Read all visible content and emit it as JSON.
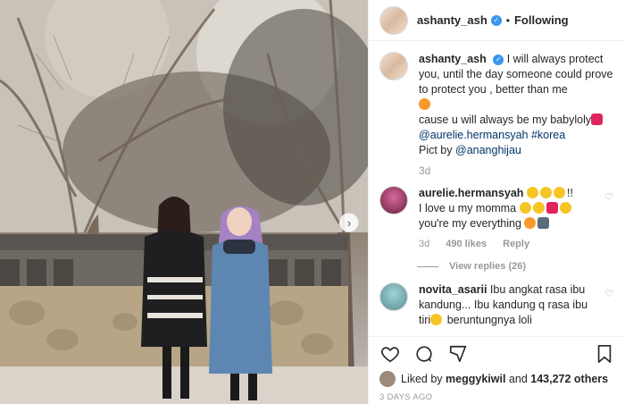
{
  "header": {
    "username": "ashanty_ash",
    "separator": "•",
    "follow_label": "Following"
  },
  "caption": {
    "username": "ashanty_ash",
    "line1": "I will always protect you, until the day someone could prove to protect you , better than me",
    "line2": "cause u will always be my babyloly",
    "mention1": "@aurelie.hermansyah",
    "hashtag": "#korea",
    "credit_prefix": "Pict by",
    "mention2": "@ananghijau",
    "time": "3d"
  },
  "comments": [
    {
      "username": "aurelie.hermansyah",
      "text_a": "!!",
      "text_b": "I love u my momma",
      "text_c": "you're my everything",
      "time": "3d",
      "likes": "490 likes",
      "reply": "Reply",
      "view_replies": "View replies (26)"
    },
    {
      "username": "novita_asarii",
      "text": "Ibu angkat rasa ibu kandung... Ibu kandung q rasa ibu tiri",
      "text_tail": "beruntungnya loli"
    }
  ],
  "likes": {
    "prefix": "Liked by",
    "user": "meggykiwil",
    "conj": "and",
    "others": "143,272 others"
  },
  "posted_ago": "3 DAYS AGO",
  "icons": {
    "like": "heart-icon",
    "comment": "comment-icon",
    "share": "share-icon",
    "save": "bookmark-icon",
    "next": "chevron-right-icon"
  },
  "colors": {
    "verified": "#3897f0",
    "mention": "#003569",
    "muted": "#999999"
  }
}
